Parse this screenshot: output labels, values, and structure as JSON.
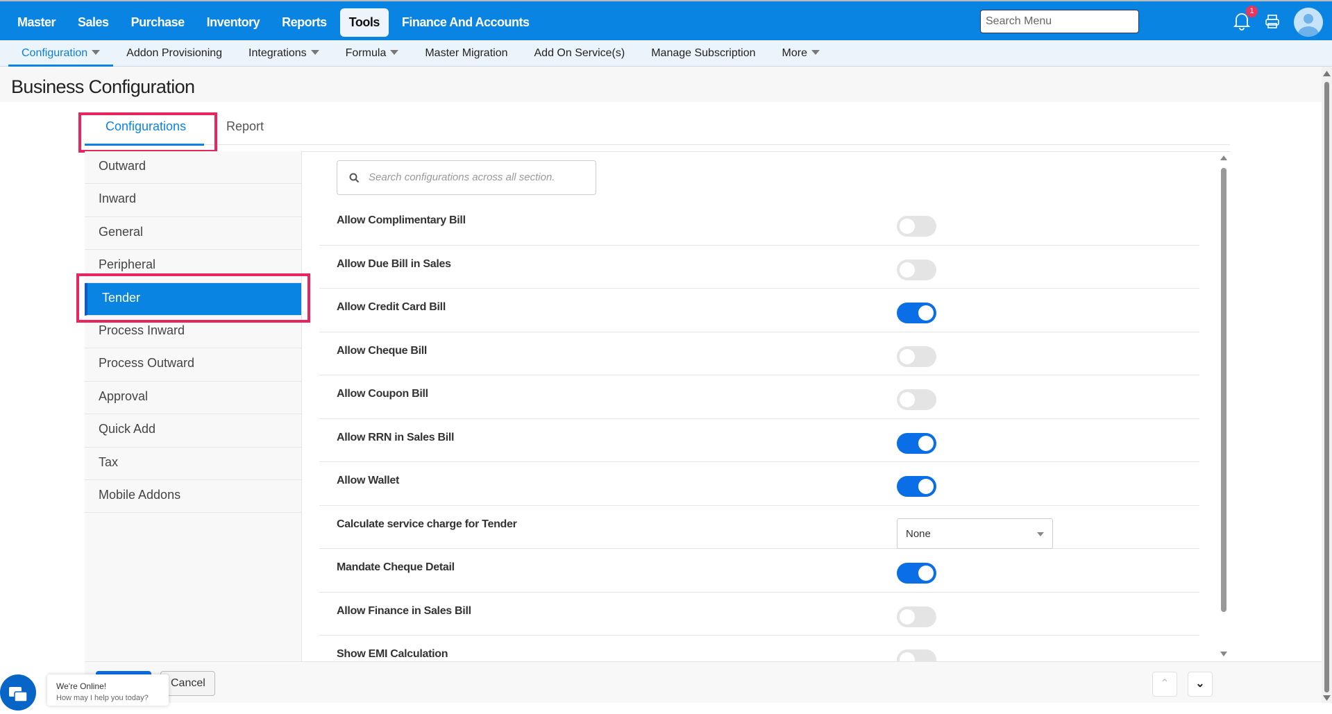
{
  "topnav": {
    "items": [
      "Master",
      "Sales",
      "Purchase",
      "Inventory",
      "Reports",
      "Tools",
      "Finance And Accounts"
    ],
    "active": "Tools",
    "search_placeholder": "Search Menu",
    "notification_count": "1"
  },
  "subnav": {
    "items": [
      {
        "label": "Configuration",
        "caret": true
      },
      {
        "label": "Addon Provisioning"
      },
      {
        "label": "Integrations",
        "caret": true
      },
      {
        "label": "Formula",
        "caret": true
      },
      {
        "label": "Master Migration"
      },
      {
        "label": "Add On Service(s)"
      },
      {
        "label": "Manage Subscription"
      },
      {
        "label": "More",
        "caret": true
      }
    ]
  },
  "page": {
    "title": "Business Configuration"
  },
  "tabs": {
    "configurations": "Configurations",
    "report": "Report"
  },
  "sidebar": {
    "items": [
      "Outward",
      "Inward",
      "General",
      "Peripheral",
      "Tender",
      "Process Inward",
      "Process Outward",
      "Approval",
      "Quick Add",
      "Tax",
      "Mobile Addons"
    ],
    "active": "Tender"
  },
  "content": {
    "search_placeholder": "Search configurations across all section.",
    "rows": [
      {
        "label": "Allow Complimentary Bill",
        "type": "toggle",
        "on": false
      },
      {
        "label": "Allow Due Bill in Sales",
        "type": "toggle",
        "on": false
      },
      {
        "label": "Allow Credit Card Bill",
        "type": "toggle",
        "on": true
      },
      {
        "label": "Allow Cheque Bill",
        "type": "toggle",
        "on": false
      },
      {
        "label": "Allow Coupon Bill",
        "type": "toggle",
        "on": false
      },
      {
        "label": "Allow RRN in Sales Bill",
        "type": "toggle",
        "on": true
      },
      {
        "label": "Allow Wallet",
        "type": "toggle",
        "on": true
      },
      {
        "label": "Calculate service charge for Tender",
        "type": "select",
        "value": "None"
      },
      {
        "label": "Mandate Cheque Detail",
        "type": "toggle",
        "on": true
      },
      {
        "label": "Allow Finance in Sales Bill",
        "type": "toggle",
        "on": false
      },
      {
        "label": "Show EMI Calculation",
        "type": "toggle",
        "on": false
      }
    ]
  },
  "footer": {
    "cancel": "Cancel"
  },
  "chat": {
    "title": "We're Online!",
    "subtitle": "How may I help you today?"
  },
  "colors": {
    "primary": "#0a84e3",
    "highlight": "#e8265e"
  }
}
